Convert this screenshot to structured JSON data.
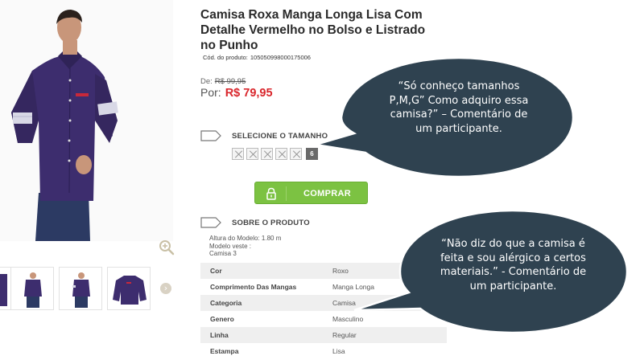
{
  "product": {
    "title": "Camisa Roxa Manga Longa Lisa Com Detalhe Vermelho no Bolso e Listrado no Punho",
    "code_label": "Cód. do produto:",
    "code_value": "105050998000175006",
    "price_old_label": "De:",
    "price_old": "R$ 99,95",
    "price_new_label": "Por:",
    "price_new": "R$ 79,95"
  },
  "size_section": {
    "label": "SELECIONE O TAMANHO",
    "sizes": [
      {
        "label": "",
        "available": false
      },
      {
        "label": "",
        "available": false
      },
      {
        "label": "",
        "available": false
      },
      {
        "label": "",
        "available": false
      },
      {
        "label": "",
        "available": false
      },
      {
        "label": "6",
        "available": true
      }
    ]
  },
  "buy_button": {
    "label": "COMPRAR",
    "icon": "lock-icon"
  },
  "about_section": {
    "label": "SOBRE O PRODUTO",
    "model_height": "Altura do Modelo: 1.80 m",
    "model_wears": "Modelo veste :",
    "model_size": "Camisa 3"
  },
  "attributes": [
    {
      "key": "Cor",
      "value": "Roxo"
    },
    {
      "key": "Comprimento Das Mangas",
      "value": "Manga Longa"
    },
    {
      "key": "Categoria",
      "value": "Camisa"
    },
    {
      "key": "Genero",
      "value": "Masculino"
    },
    {
      "key": "Linha",
      "value": "Regular"
    },
    {
      "key": "Estampa",
      "value": "Lisa"
    }
  ],
  "comments": [
    {
      "lines": [
        "“Só conheço tamanhos",
        "P,M,G” Como adquiro essa",
        "camisa?” – Comentário de",
        "um participante."
      ]
    },
    {
      "lines": [
        "“Não diz do que a camisa é",
        "feita e sou alérgico a certos",
        "materiais.” - Comentário de",
        "um participante."
      ]
    }
  ],
  "colors": {
    "price_red": "#d9262c",
    "buy_green": "#7cc242",
    "bubble_fill": "#2f4250",
    "shirt_purple": "#3d2d6e"
  },
  "icons": {
    "zoom": "zoom-in-icon",
    "thumbnail_next": "chevron-right-icon",
    "section_tag": "tag-icon"
  }
}
